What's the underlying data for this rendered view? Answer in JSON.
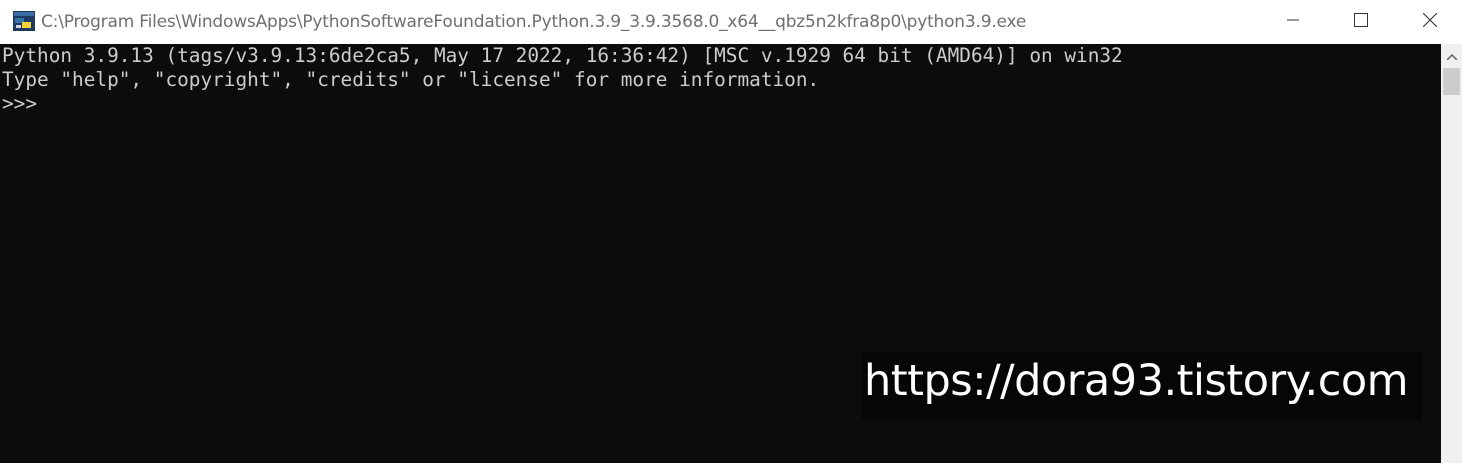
{
  "window": {
    "title": "C:\\Program Files\\WindowsApps\\PythonSoftwareFoundation.Python.3.9_3.9.3568.0_x64__qbz5n2kfra8p0\\python3.9.exe",
    "controls": {
      "minimize_icon": "minimize-icon",
      "maximize_icon": "maximize-icon",
      "close_icon": "close-icon"
    }
  },
  "console": {
    "lines": [
      "Python 3.9.13 (tags/v3.9.13:6de2ca5, May 17 2022, 16:36:42) [MSC v.1929 64 bit (AMD64)] on win32",
      "Type \"help\", \"copyright\", \"credits\" or \"license\" for more information.",
      ">>> "
    ],
    "background": "#0c0c0c",
    "foreground": "#cccccc"
  },
  "watermark": {
    "text": "https://dora93.tistory.com"
  }
}
